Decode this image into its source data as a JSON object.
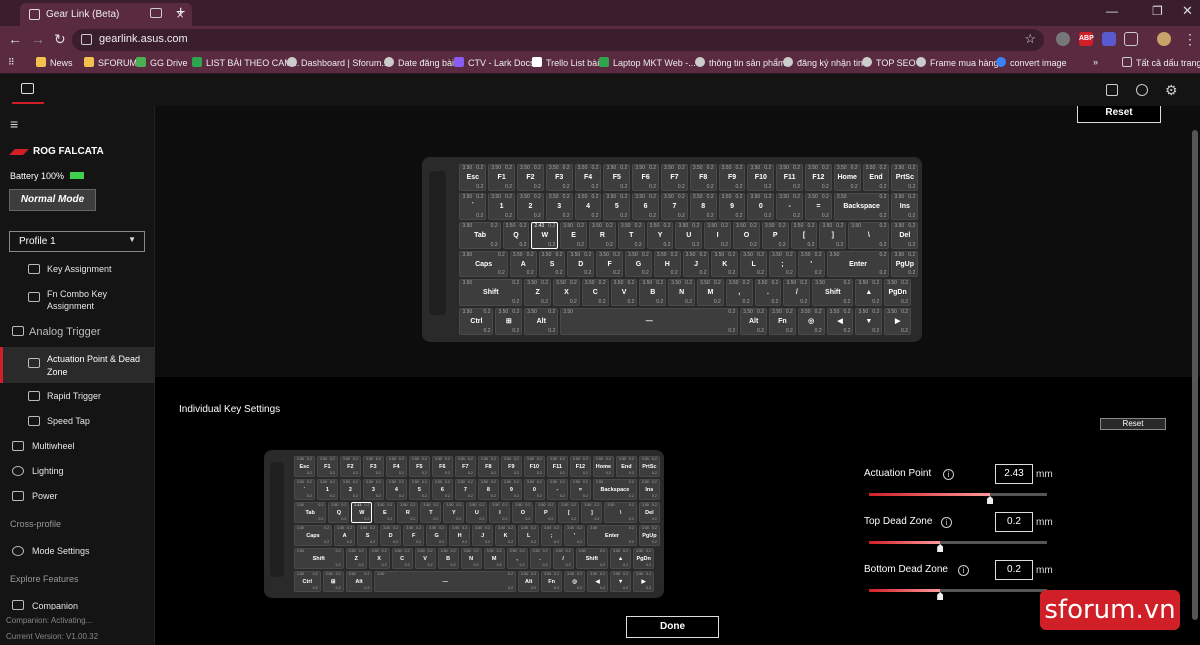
{
  "browser": {
    "tab_title": "Gear Link (Beta)",
    "url": "gearlink.asus.com",
    "bookmarks": [
      "News",
      "SFORUM",
      "GG Drive",
      "LIST BÀI THEO CAM...",
      "Dashboard | Sforum...",
      "Date đăng bài",
      "CTV - Lark Docs",
      "Trello List bài",
      "Laptop MKT Web -...",
      "thông tin sản phẩm",
      "đăng ký nhận tin",
      "TOP SEO",
      "Frame mua hàng",
      "convert image"
    ],
    "all_bookmarks": "Tất cả dấu trang",
    "ext_abp": "ABP"
  },
  "sidebar": {
    "device_name": "ROG FALCATA",
    "battery": "Battery 100%",
    "mode": "Normal Mode",
    "profile": "Profile 1",
    "items": [
      {
        "label": "Key Assignment",
        "level": "sub"
      },
      {
        "label": "Fn Combo Key\nAssignment",
        "level": "sub"
      },
      {
        "label": "Analog Trigger",
        "level": "group"
      },
      {
        "label": "Actuation Point & Dead\nZone",
        "level": "sub",
        "active": true
      },
      {
        "label": "Rapid Trigger",
        "level": "sub"
      },
      {
        "label": "Speed Tap",
        "level": "sub"
      },
      {
        "label": "Multiwheel",
        "level": "top"
      },
      {
        "label": "Lighting",
        "level": "top"
      },
      {
        "label": "Power",
        "level": "top"
      },
      {
        "label": "Cross-profile",
        "level": "section"
      },
      {
        "label": "Mode Settings",
        "level": "top"
      },
      {
        "label": "Explore Features",
        "level": "section"
      },
      {
        "label": "Companion",
        "level": "top"
      }
    ],
    "status_activating": "Companion: Activating...",
    "version": "Current Version: V1.00.32"
  },
  "main": {
    "reset_top": "Reset",
    "section_title": "Individual Key Settings",
    "reset_individual": "Reset",
    "done": "Done",
    "settings": [
      {
        "label": "Actuation Point",
        "value": "2.43",
        "unit": "mm",
        "fraction": 0.68
      },
      {
        "label": "Top Dead Zone",
        "value": "0.2",
        "unit": "mm",
        "fraction": 0.4
      },
      {
        "label": "Bottom Dead Zone",
        "value": "0.2",
        "unit": "mm",
        "fraction": 0.4
      }
    ]
  },
  "keyboard": {
    "default_top": "3.50",
    "default_right": "0.2",
    "selected_value": "2.43",
    "rows": [
      [
        "Esc",
        "F1",
        "F2",
        "F3",
        "F4",
        "F5",
        "F6",
        "F7",
        "F8",
        "F9",
        "F10",
        "F11",
        "F12",
        "Home",
        "End",
        "PrtSc"
      ],
      [
        "`",
        "1",
        "2",
        "3",
        "4",
        "5",
        "6",
        "7",
        "8",
        "9",
        "0",
        "-",
        "=",
        "Backspace",
        "Ins"
      ],
      [
        "Tab",
        "Q",
        "W",
        "E",
        "R",
        "T",
        "Y",
        "U",
        "I",
        "O",
        "P",
        "[",
        "]",
        "\\",
        "Del"
      ],
      [
        "Caps",
        "A",
        "S",
        "D",
        "F",
        "G",
        "H",
        "J",
        "K",
        "L",
        ";",
        "'",
        "Enter",
        "PgUp"
      ],
      [
        "Shift",
        "Z",
        "X",
        "C",
        "V",
        "B",
        "N",
        "M",
        ",",
        ".",
        "/",
        "Shift",
        "▲",
        "PgDn"
      ],
      [
        "Ctrl",
        "⊞",
        "Alt",
        "—",
        "Alt",
        "Fn",
        "◎",
        "◀",
        "▼",
        "▶"
      ]
    ]
  },
  "watermark": "sforum.vn"
}
